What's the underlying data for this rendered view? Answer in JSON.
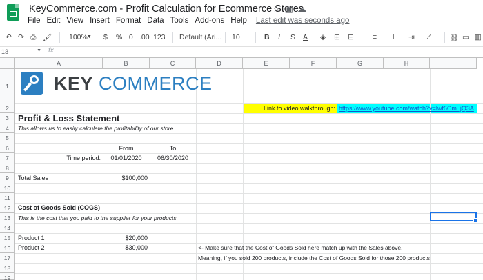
{
  "window": {
    "doc_title": "KeyCommerce.com - Profit Calculation for Ecommerce Stores",
    "title_icons": [
      "star-icon",
      "folder-icon",
      "cloud-icon"
    ]
  },
  "menu": {
    "items": [
      "File",
      "Edit",
      "View",
      "Insert",
      "Format",
      "Data",
      "Tools",
      "Add-ons",
      "Help"
    ],
    "last_edit": "Last edit was seconds ago"
  },
  "toolbar": {
    "zoom": "100%",
    "currency": "$",
    "percent": "%",
    "dec_decrease": ".0",
    "dec_increase": ".00",
    "more_formats": "123",
    "font": "Default (Ari...",
    "font_size": "10",
    "bold": "B",
    "italic": "I",
    "strike": "S",
    "text_color": "A"
  },
  "formula_bar": {
    "name_box": "13",
    "fx": "fx"
  },
  "columns": [
    "A",
    "B",
    "C",
    "D",
    "E",
    "F",
    "G",
    "H",
    "I"
  ],
  "rows": [
    "1",
    "2",
    "3",
    "4",
    "5",
    "6",
    "7",
    "8",
    "9",
    "10",
    "11",
    "12",
    "13",
    "14",
    "15",
    "16",
    "17",
    "18",
    "19"
  ],
  "logo": {
    "key": "KEY",
    "commerce": "COMMERCE"
  },
  "sheet": {
    "walkthrough_label": "Link to video walkthrough:",
    "walkthrough_url": "https://www.youtube.com/watch?v=lwf6Cm_jQ3A",
    "heading": "Profit & Loss Statement",
    "subheading": "This allows us to easily calculate the profitability of our store.",
    "from_label": "From",
    "to_label": "To",
    "time_period_label": "Time period:",
    "from_date": "01/01/2020",
    "to_date": "06/30/2020",
    "total_sales_label": "Total Sales",
    "total_sales_value": "$100,000",
    "cogs_heading": "Cost of Goods Sold (COGS)",
    "cogs_note": "This is the cost that you paid to the supplier for your products",
    "product1_label": "Product 1",
    "product1_value": "$20,000",
    "product2_label": "Product 2",
    "product2_value": "$30,000",
    "note_line1": "<- Make sure that the Cost of Goods Sold here match up with the Sales above.",
    "note_line2": "Meaning, if you sold 200 products, include the Cost of Goods Sold for those 200 products"
  },
  "colors": {
    "accent": "#1a73e8",
    "highlight_yellow": "#ffff00",
    "highlight_cyan": "#00ffff",
    "logo_blue": "#2c7fc1"
  }
}
